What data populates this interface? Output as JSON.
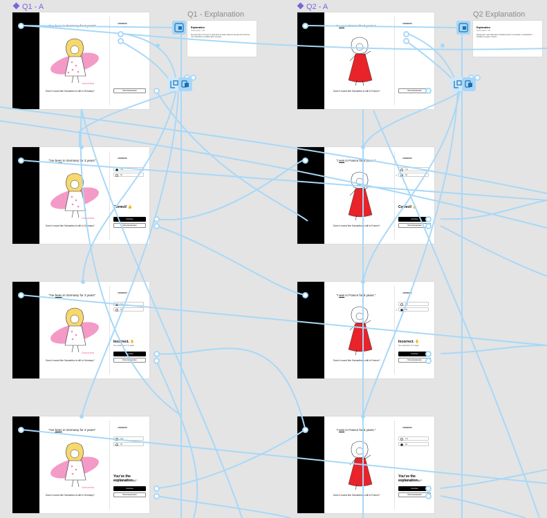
{
  "canvas": {
    "labels": {
      "q1_component": "Q1 - A",
      "q1_explanation": "Q1 - Explanation",
      "q2_component": "Q2 - A",
      "q2_explanation": "Q2 Explanation"
    }
  },
  "q1": {
    "sentence_pre": "\"I've ",
    "sentence_verb": "been",
    "sentence_post": " in Germany for 3 years\"",
    "question": "Does it sound like Samantha is still in Germany?",
    "caption": "Samantha",
    "answers_heading": "ANSWERS",
    "option_yes": "Yes",
    "option_no": "No",
    "correct": "Correct! 👍",
    "incorrect": "Incorrect. ✋",
    "incorrect_sub": "See explanation or try again",
    "explanation_title": "You’ve the explanation...",
    "explanation_sub": "Learn something with checking it",
    "continue": "Continue",
    "show_explanation": "Show Explanation"
  },
  "q2": {
    "sentence_pre": "\"I ",
    "sentence_verb": "was",
    "sentence_post": " in France for 5 years.\"",
    "question": "Does it sound like Samantha is still in France?",
    "answers_heading": "ANSWERS",
    "option_yes": "Yes",
    "option_no": "No",
    "correct": "Correct! 👍",
    "incorrect": "Incorrect. ✋",
    "incorrect_sub": "See explanation or try again",
    "explanation_title": "You’ve the explanation...",
    "explanation_sub": "Learn something with checking it",
    "continue": "Continue",
    "show_explanation": "Show Explanation"
  },
  "explanation_cards": {
    "q1": {
      "title": "Explanation",
      "sub": "Lorem ipsum · No",
      "body": "Present perfect \"I've been\" is used when an action started in the past and is still true now. Samantha is probably still in Germany."
    },
    "q2": {
      "title": "Explanation",
      "sub": "Lorem ipsum · No",
      "body": "Simple past \"I was\" talks about a finished period. It is complete, so Samantha is probably no longer in France."
    }
  },
  "colors": {
    "wire": "#a7d8f8",
    "node": "#a8d6f7",
    "component_label": "#7d62d9",
    "frame_label": "#8a8a8a"
  },
  "icons": [
    "prototype-flow-icon",
    "variant-swap-icon",
    "component-diamond-icon",
    "connection-dot-icon"
  ]
}
